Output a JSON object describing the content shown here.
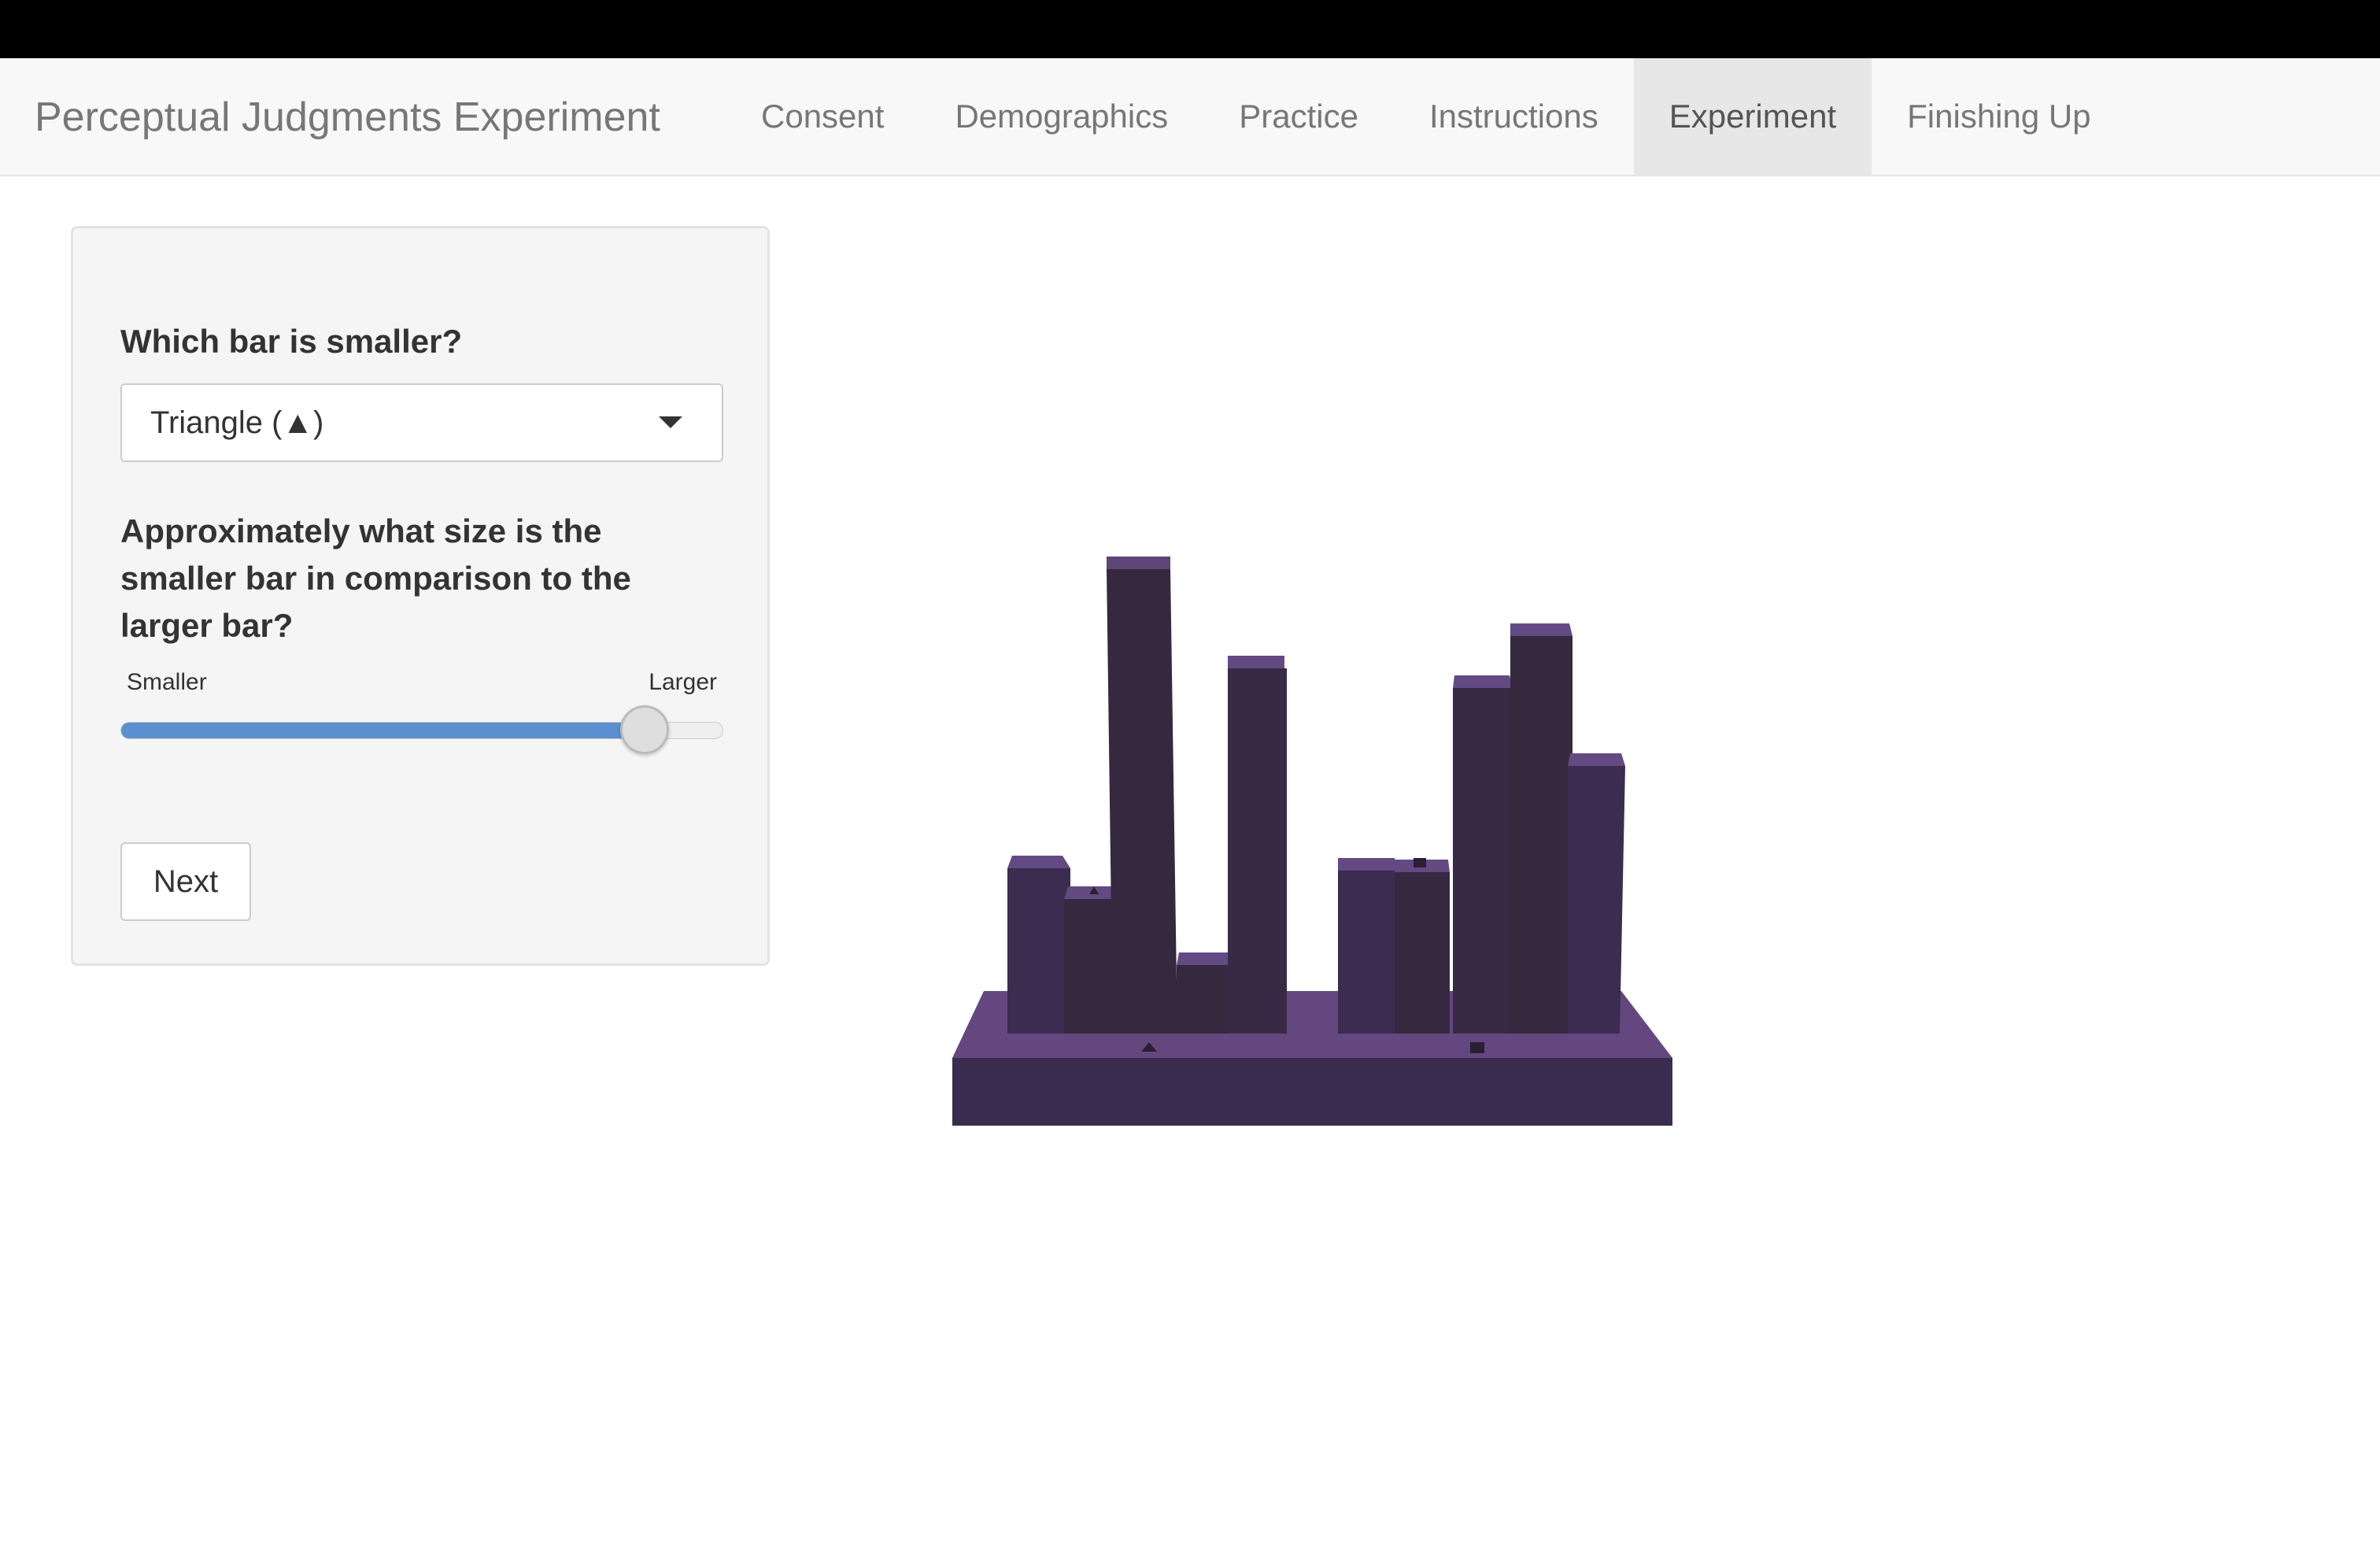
{
  "window": {
    "top_bar_color": "#000000"
  },
  "navbar": {
    "brand": "Perceptual Judgments Experiment",
    "tabs": [
      {
        "label": "Consent",
        "active": false
      },
      {
        "label": "Demographics",
        "active": false
      },
      {
        "label": "Practice",
        "active": false
      },
      {
        "label": "Instructions",
        "active": false
      },
      {
        "label": "Experiment",
        "active": true
      },
      {
        "label": "Finishing Up",
        "active": false
      }
    ]
  },
  "form": {
    "question1": "Which bar is smaller?",
    "select_value": "Triangle (▲)",
    "question2": "Approximately what size is the smaller bar in comparison to the larger bar?",
    "slider": {
      "min_label": "Smaller",
      "max_label": "Larger",
      "value_fraction": 0.87,
      "fill_color": "#5b8fd0"
    },
    "next_label": "Next"
  },
  "stimulus": {
    "type": "3d-bar-chart",
    "bar_color": "#3d2d52",
    "base_color": "#64477f"
  }
}
